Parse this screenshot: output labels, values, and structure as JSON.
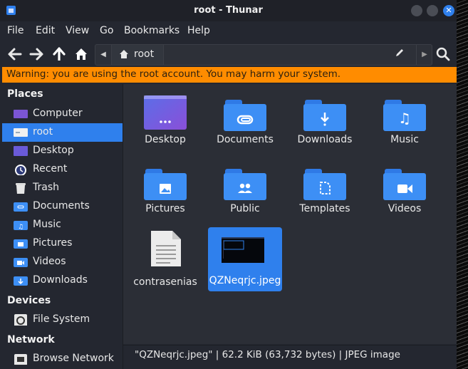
{
  "window": {
    "title": "root - Thunar"
  },
  "menu": [
    "File",
    "Edit",
    "View",
    "Go",
    "Bookmarks",
    "Help"
  ],
  "toolbar": {
    "path_crumb": "root"
  },
  "warning": "Warning: you are using the root account. You may harm your system.",
  "sidebar": {
    "places_title": "Places",
    "places": [
      {
        "label": "Computer",
        "icon": "computer-icon"
      },
      {
        "label": "root",
        "icon": "home-folder-icon",
        "selected": true
      },
      {
        "label": "Desktop",
        "icon": "desktop-icon"
      },
      {
        "label": "Recent",
        "icon": "recent-icon"
      },
      {
        "label": "Trash",
        "icon": "trash-icon"
      },
      {
        "label": "Documents",
        "icon": "documents-folder-icon"
      },
      {
        "label": "Music",
        "icon": "music-folder-icon"
      },
      {
        "label": "Pictures",
        "icon": "pictures-folder-icon"
      },
      {
        "label": "Videos",
        "icon": "videos-folder-icon"
      },
      {
        "label": "Downloads",
        "icon": "downloads-folder-icon"
      }
    ],
    "devices_title": "Devices",
    "devices": [
      {
        "label": "File System",
        "icon": "drive-icon"
      }
    ],
    "network_title": "Network",
    "network": [
      {
        "label": "Browse Network",
        "icon": "network-icon"
      }
    ]
  },
  "files": [
    {
      "name": "Desktop",
      "icon": "desktop-icon"
    },
    {
      "name": "Documents",
      "icon": "documents-folder-icon"
    },
    {
      "name": "Downloads",
      "icon": "downloads-folder-icon"
    },
    {
      "name": "Music",
      "icon": "music-folder-icon"
    },
    {
      "name": "Pictures",
      "icon": "pictures-folder-icon"
    },
    {
      "name": "Public",
      "icon": "public-folder-icon"
    },
    {
      "name": "Templates",
      "icon": "templates-folder-icon"
    },
    {
      "name": "Videos",
      "icon": "videos-folder-icon"
    },
    {
      "name": "contrasenias",
      "icon": "text-file-icon"
    },
    {
      "name": "QZNeqrjc.jpeg",
      "icon": "image-thumbnail-icon",
      "selected": true
    }
  ],
  "status": "\"QZNeqrjc.jpeg\" | 62.2 KiB (63,732 bytes) | JPEG image",
  "colors": {
    "accent": "#2f80ed",
    "warning": "#ff8c00",
    "background": "#2b2e36"
  }
}
